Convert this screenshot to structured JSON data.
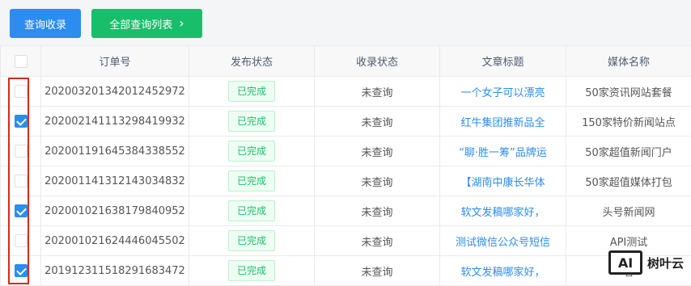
{
  "toolbar": {
    "query_label": "查询收录",
    "all_list_label": "全部查询列表",
    "all_list_icon": "chevron-right-icon"
  },
  "table": {
    "headers": [
      "订单号",
      "发布状态",
      "收录状态",
      "文章标题",
      "媒体名称"
    ],
    "rows": [
      {
        "checked": false,
        "order": "20200320134201245297​2",
        "publish": "已完成",
        "index": "未查询",
        "title": "一个女子可以漂亮",
        "media": "50家资讯网站套餐"
      },
      {
        "checked": true,
        "order": "20200214111329841993​2",
        "publish": "已完成",
        "index": "未查询",
        "title": "红牛集团推新品全",
        "media": "150家特价新闻站点"
      },
      {
        "checked": false,
        "order": "20200119164538433855​2",
        "publish": "已完成",
        "index": "未查询",
        "title": "“聊·胜一筹”品牌运",
        "media": "50家超值新闻门户"
      },
      {
        "checked": false,
        "order": "20200114131214303483​2",
        "publish": "已完成",
        "index": "未查询",
        "title": "【湖南中康长华体",
        "media": "50家超值媒体打包"
      },
      {
        "checked": true,
        "order": "20200102163817984095​2",
        "publish": "已完成",
        "index": "未查询",
        "title": "软文发稿哪家好，",
        "media": "头号新闻网"
      },
      {
        "checked": false,
        "order": "20200102162444604550​2",
        "publish": "已完成",
        "index": "未查询",
        "title": "测试微信公众号短信",
        "media": "API测试"
      },
      {
        "checked": true,
        "order": "20191231151829168347​2",
        "publish": "已完成",
        "index": "未查询",
        "title": "软文发稿哪家好，",
        "media": "者"
      }
    ]
  },
  "watermark": {
    "logo_text": "AI",
    "brand": "树叶云"
  },
  "colors": {
    "primary": "#2d8cf0",
    "success": "#19be6b",
    "highlight": "#e1251b"
  }
}
